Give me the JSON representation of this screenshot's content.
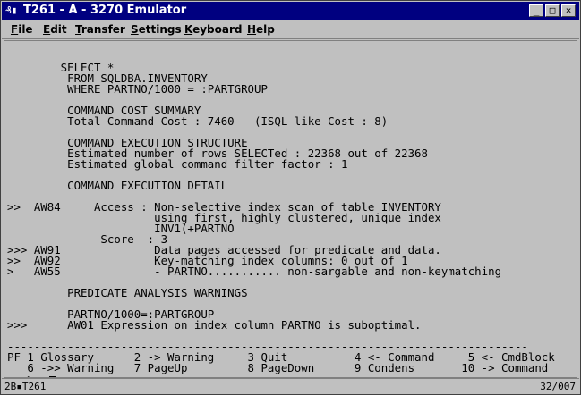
{
  "window": {
    "title": "T261 - A - 3270 Emulator",
    "app_icon": "₰▮",
    "controls": {
      "minimize": "_",
      "maximize": "□",
      "close": "×"
    }
  },
  "menu": {
    "file": {
      "underline": "F",
      "rest": "ile"
    },
    "edit": {
      "underline": "E",
      "rest": "dit"
    },
    "transfer": {
      "underline": "T",
      "rest": "ransfer"
    },
    "settings": {
      "underline": "S",
      "rest": "ettings"
    },
    "keyboard": {
      "underline": "K",
      "rest": "eyboard"
    },
    "help": {
      "underline": "H",
      "rest": "elp"
    }
  },
  "screen": {
    "lines": [
      "",
      "",
      "        SELECT *",
      "         FROM SQLDBA.INVENTORY",
      "         WHERE PARTNO/1000 = :PARTGROUP",
      "",
      "         COMMAND COST SUMMARY",
      "         Total Command Cost : 7460   (ISQL like Cost : 8)",
      "",
      "         COMMAND EXECUTION STRUCTURE",
      "         Estimated number of rows SELECTed : 22368 out of 22368",
      "         Estimated global command filter factor : 1",
      "",
      "         COMMAND EXECUTION DETAIL",
      "",
      ">>  AW84     Access : Non-selective index scan of table INVENTORY",
      "                      using first, highly clustered, unique index",
      "                      INV1(+PARTNO",
      "              Score  : 3",
      ">>> AW91              Data pages accessed for predicate and data.",
      ">>  AW92              Key-matching index columns: 0 out of 1",
      ">   AW55              - PARTNO........... non-sargable and non-keymatching",
      "",
      "         PREDICATE ANALYSIS WARNINGS",
      "",
      "         PARTNO/1000=:PARTGROUP",
      ">>>      AW01 Expression on index column PARTNO is suboptimal.",
      "",
      "------------------------------------------------------------------------------",
      "PF 1 Glossary      2 -> Warning     3 Quit          4 <- Command     5 <- CmdBlock",
      "   6 ->> Warning   7 PageUp         8 PageDown      9 Condens       10 -> Command",
      "===>"
    ]
  },
  "status": {
    "left": "2B▪T261",
    "right": "32/007"
  }
}
